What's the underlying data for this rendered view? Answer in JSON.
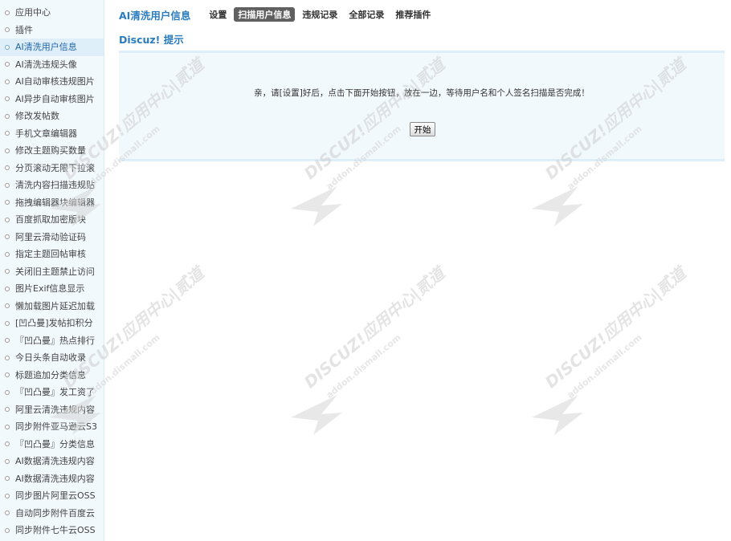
{
  "sidebar": {
    "items": [
      {
        "label": "应用中心"
      },
      {
        "label": "插件"
      },
      {
        "label": "AI清洗用户信息",
        "active": true
      },
      {
        "label": "AI清洗违规头像"
      },
      {
        "label": "AI自动审核违规图片"
      },
      {
        "label": "AI异步自动审核图片"
      },
      {
        "label": "修改发帖数"
      },
      {
        "label": "手机文章编辑器"
      },
      {
        "label": "修改主题购买数量"
      },
      {
        "label": "分页滚动无限下拉滚"
      },
      {
        "label": "清洗内容扫描违规贴"
      },
      {
        "label": "拖拽编辑器块编辑器"
      },
      {
        "label": "百度抓取加密版块"
      },
      {
        "label": "阿里云滑动验证码"
      },
      {
        "label": "指定主题回帖审核"
      },
      {
        "label": "关闭旧主题禁止访问"
      },
      {
        "label": "图片Exif信息显示"
      },
      {
        "label": "懒加载图片延迟加载"
      },
      {
        "label": "[凹凸曼]发帖扣积分"
      },
      {
        "label": "『凹凸曼』热点排行"
      },
      {
        "label": "今日头条自动收录"
      },
      {
        "label": "标题追加分类信息"
      },
      {
        "label": "『凹凸曼』发工资了"
      },
      {
        "label": "阿里云清洗违规内容"
      },
      {
        "label": "同步附件亚马逊云S3"
      },
      {
        "label": "『凹凸曼』分类信息"
      },
      {
        "label": "AI数据清洗违规内容"
      },
      {
        "label": "AI数据清洗违规内容"
      },
      {
        "label": "同步图片阿里云OSS"
      },
      {
        "label": "自动同步附件百度云"
      },
      {
        "label": "同步附件七牛云OSS"
      }
    ]
  },
  "header": {
    "plugin_title": "AI清洗用户信息",
    "tabs": [
      {
        "label": "设置"
      },
      {
        "label": "扫描用户信息",
        "active": true
      },
      {
        "label": "违规记录"
      },
      {
        "label": "全部记录"
      },
      {
        "label": "推荐插件"
      }
    ]
  },
  "main": {
    "section_title": "Discuz! 提示",
    "message": "亲，请[设置]好后，点击下面开始按钮，放在一边，等待用户名和个人签名扫描是否完成！",
    "start_button": "开始"
  },
  "watermark": {
    "brand": "DISCUZ!应用中心|贰道",
    "domain": "addon.dismall.com"
  },
  "colors": {
    "accent": "#2a7cbf",
    "sidebar_bg": "#f2f9fd",
    "active_tab_bg": "#606060"
  }
}
